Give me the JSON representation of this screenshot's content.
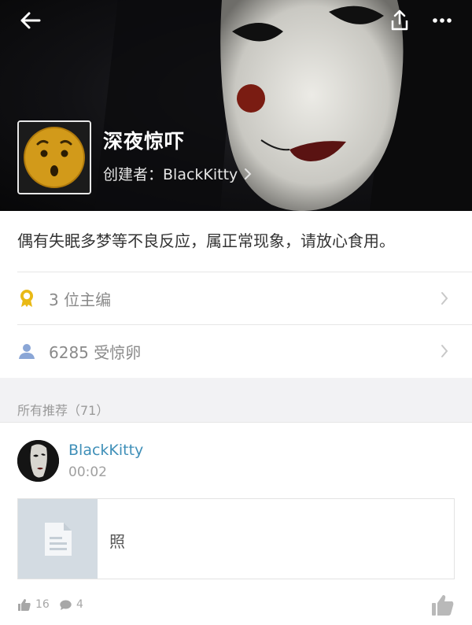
{
  "header": {
    "icons": {
      "back": "back-arrow-icon",
      "share": "share-icon",
      "more": "more-dots-icon"
    }
  },
  "topic": {
    "title": "深夜惊吓",
    "creator_label": "创建者：BlackKitty",
    "description": "偶有失眠多梦等不良反应，属正常现象，请放心食用。"
  },
  "stats_rows": [
    {
      "icon": "award-ribbon-icon",
      "text": "3 位主编"
    },
    {
      "icon": "person-icon",
      "text": "6285 受惊卵"
    }
  ],
  "recommendations": {
    "label": "所有推荐（71）",
    "post": {
      "author": "BlackKitty",
      "time": "00:02",
      "card_title": "照",
      "likes": "16",
      "comments": "4"
    }
  },
  "colors": {
    "accent": "#3f8fb8",
    "award": "#e9b915",
    "person": "#8aa6d6"
  }
}
